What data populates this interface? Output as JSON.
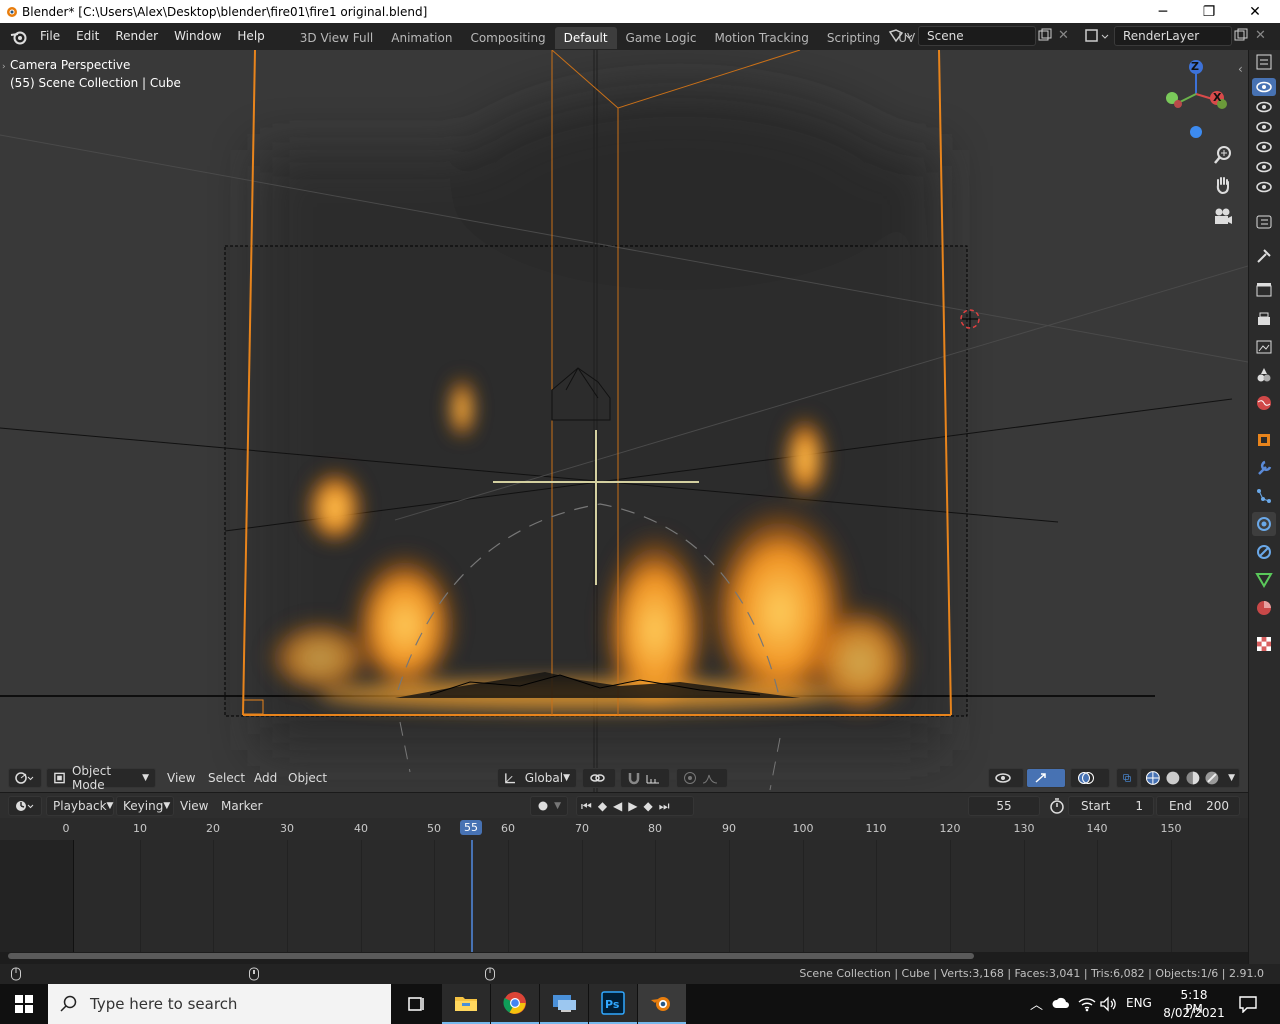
{
  "window": {
    "title": "Blender* [C:\\Users\\Alex\\Desktop\\blender\\fire01\\fire1 original.blend]",
    "minimize": "─",
    "maximize": "❐",
    "close": "✕"
  },
  "menu": [
    "File",
    "Edit",
    "Render",
    "Window",
    "Help"
  ],
  "workspaces": [
    {
      "label": "3D View Full",
      "active": false
    },
    {
      "label": "Animation",
      "active": false
    },
    {
      "label": "Compositing",
      "active": false
    },
    {
      "label": "Default",
      "active": true
    },
    {
      "label": "Game Logic",
      "active": false
    },
    {
      "label": "Motion Tracking",
      "active": false
    },
    {
      "label": "Scripting",
      "active": false
    },
    {
      "label": "UV Editing",
      "active": false
    },
    {
      "label": "V",
      "active": false
    }
  ],
  "scene_field": "Scene",
  "renderlayer_field": "RenderLayer",
  "viewport": {
    "perspective": "Camera Perspective",
    "collection": "(55) Scene Collection | Cube",
    "gizmo": {
      "z": "Z",
      "x": "X"
    }
  },
  "viewport_header": {
    "mode": "Object Mode",
    "menus": [
      "View",
      "Select",
      "Add",
      "Object"
    ],
    "orientation": "Global"
  },
  "timeline": {
    "menus": [
      "Playback",
      "Keying",
      "View",
      "Marker"
    ],
    "current_frame": "55",
    "start_label": "Start",
    "start": "1",
    "end_label": "End",
    "end": "200",
    "ticks": [
      "0",
      "10",
      "20",
      "30",
      "40",
      "50",
      "55",
      "60",
      "70",
      "80",
      "90",
      "100",
      "110",
      "120",
      "130",
      "140",
      "150"
    ]
  },
  "status": {
    "text": "Scene Collection | Cube | Verts:3,168 | Faces:3,041 | Tris:6,082 | Objects:1/6 | 2.91.0"
  },
  "taskbar": {
    "search_placeholder": "Type here to search",
    "lang": "ENG",
    "time": "5:18 PM",
    "date": "8/02/2021"
  },
  "colors": {
    "accent": "#4772b3",
    "orange": "#f0a030",
    "viewport_bg": "#393939"
  }
}
